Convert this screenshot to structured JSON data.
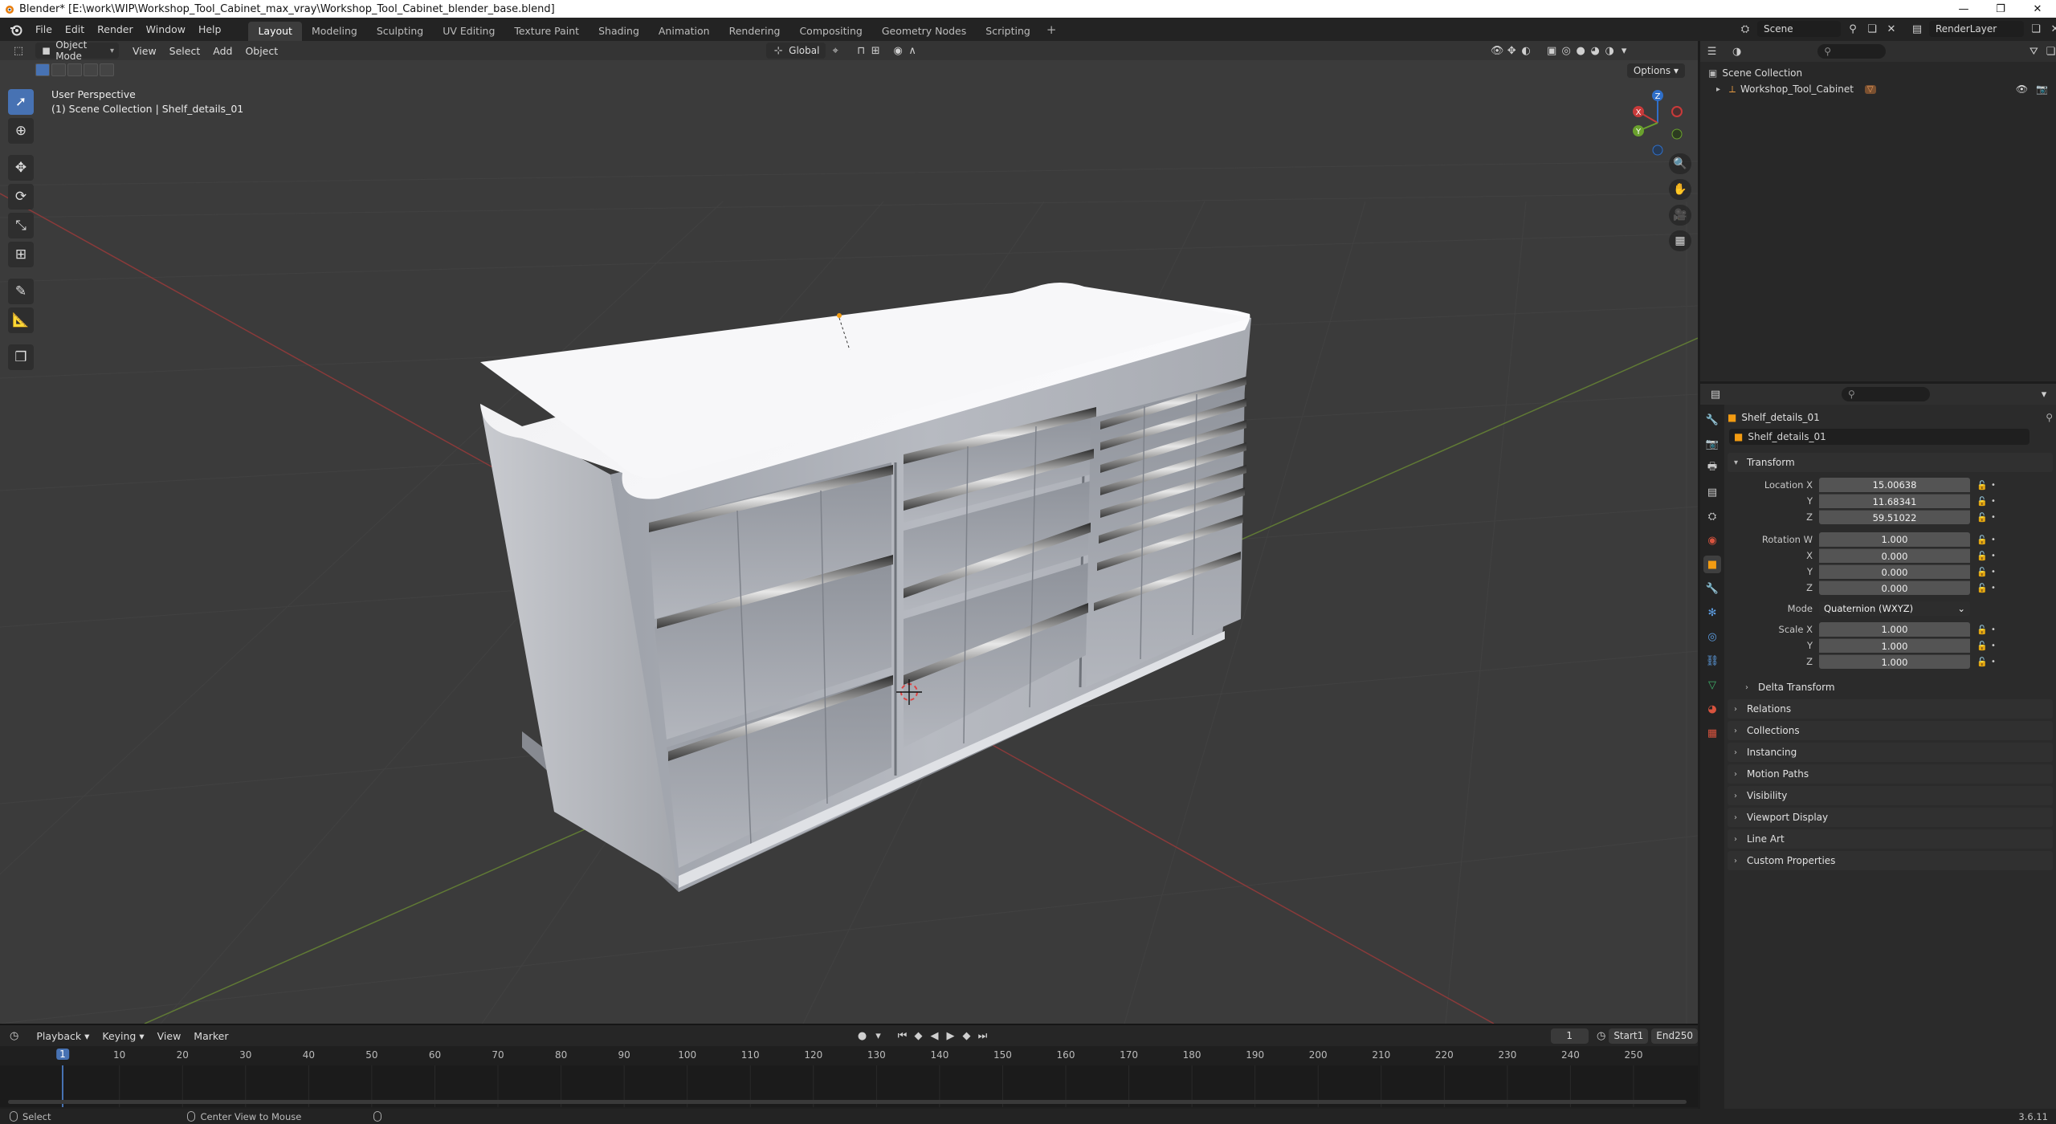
{
  "window": {
    "title": "Blender* [E:\\work\\WIP\\Workshop_Tool_Cabinet_max_vray\\Workshop_Tool_Cabinet_blender_base.blend]",
    "controls": [
      "—",
      "❐",
      "✕"
    ]
  },
  "menu": {
    "items": [
      "File",
      "Edit",
      "Render",
      "Window",
      "Help"
    ]
  },
  "workspaces": {
    "tabs": [
      "Layout",
      "Modeling",
      "Sculpting",
      "UV Editing",
      "Texture Paint",
      "Shading",
      "Animation",
      "Rendering",
      "Compositing",
      "Geometry Nodes",
      "Scripting"
    ],
    "active": "Layout",
    "add": "+"
  },
  "scene": {
    "name": "Scene",
    "view_layer": "RenderLayer"
  },
  "viewport": {
    "mode": "Object Mode",
    "menus": [
      "View",
      "Select",
      "Add",
      "Object"
    ],
    "orientation": "Global",
    "options_label": "Options",
    "view_name": "User Perspective",
    "collection_path": "(1) Scene Collection | Shelf_details_01"
  },
  "gizmo": {
    "x": "X",
    "y": "Y",
    "z": "Z"
  },
  "timeline": {
    "menus": [
      "Playback",
      "Keying",
      "View",
      "Marker"
    ],
    "current_frame": "1",
    "start_label": "Start",
    "start": "1",
    "end_label": "End",
    "end": "250",
    "ruler_current": "1",
    "ticks": [
      "10",
      "20",
      "30",
      "40",
      "50",
      "60",
      "70",
      "80",
      "90",
      "100",
      "110",
      "120",
      "130",
      "140",
      "150",
      "160",
      "170",
      "180",
      "190",
      "200",
      "210",
      "220",
      "230",
      "240",
      "250"
    ]
  },
  "status": {
    "select": "Select",
    "center": "Center View to Mouse",
    "version": "3.6.11"
  },
  "outliner": {
    "root": "Scene Collection",
    "items": [
      {
        "name": "Workshop_Tool_Cabinet"
      }
    ]
  },
  "properties": {
    "object_name": "Shelf_details_01",
    "data_name": "Shelf_details_01",
    "transform": {
      "header": "Transform",
      "location_label": "Location X",
      "location": [
        "15.00638",
        "11.68341",
        "59.51022"
      ],
      "rotation_label": "Rotation W",
      "rotation": [
        "1.000",
        "0.000",
        "0.000",
        "0.000"
      ],
      "mode_label": "Mode",
      "mode": "Quaternion (WXYZ)",
      "scale_label": "Scale X",
      "scale": [
        "1.000",
        "1.000",
        "1.000"
      ],
      "axis_y": "Y",
      "axis_z": "Z",
      "axis_x": "X"
    },
    "delta": "Delta Transform",
    "panels": [
      "Relations",
      "Collections",
      "Instancing",
      "Motion Paths",
      "Visibility",
      "Viewport Display",
      "Line Art",
      "Custom Properties"
    ]
  }
}
